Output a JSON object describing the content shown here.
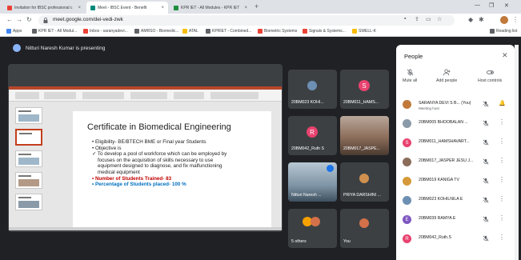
{
  "browser": {
    "tabs": [
      {
        "title": "Invitation for IBSC professional c",
        "color": "#e94235"
      },
      {
        "title": "Meet - IBSC Event - Benefit",
        "color": "#00897b"
      },
      {
        "title": "KPR IET - All Modules - KPR IET",
        "color": "#1e8e3e"
      }
    ],
    "new_tab": "+",
    "url": "meet.google.com/dei-vedi-zwk",
    "bookmarks": [
      {
        "label": "Apps",
        "color": "#4285f4"
      },
      {
        "label": "KPR IET - All Modul...",
        "color": "#5f6368"
      },
      {
        "label": "Inbox - saranyadevi...",
        "color": "#ea4335"
      },
      {
        "label": "AMRSO - Biomedic...",
        "color": "#5f6368"
      },
      {
        "label": "ATAL",
        "color": "#fbbc04"
      },
      {
        "label": "KPRIET - Combined...",
        "color": "#5f6368"
      },
      {
        "label": "Biometric Systems",
        "color": "#ea4335"
      },
      {
        "label": "Signals & Systems...",
        "color": "#ea4335"
      },
      {
        "label": "SWELL-K",
        "color": "#fbbc04"
      },
      {
        "label": "Reading list",
        "color": "#5f6368"
      }
    ]
  },
  "meet": {
    "presenter_banner": "Nitturi Naresh Kumar is presenting",
    "slide": {
      "title": "Certificate in Biomedical Engineering",
      "bullets": [
        {
          "text": "• Eligibility- BE/BTECH BME or Final year Students",
          "style": "normal"
        },
        {
          "text": "• Objective is",
          "style": "normal"
        },
        {
          "text": "✓ To develop a pool of workforce which can be employed by",
          "style": "normal"
        },
        {
          "text": "focuses on the acquisition of skills necessary to use",
          "style": "indent"
        },
        {
          "text": "equipment designed to diagnose, and fix malfunctioning",
          "style": "indent"
        },
        {
          "text": "medical equipment",
          "style": "indent"
        },
        {
          "text": "• Number of Students Trained- 83",
          "style": "red"
        },
        {
          "text": "• Percentage of Students placed- 100 %",
          "style": "blue"
        }
      ]
    },
    "tiles": [
      {
        "name": "20BM023 KOHI...",
        "kind": "photo",
        "avatar_color": "#6d8fb3"
      },
      {
        "name": "20BM011_HAMS...",
        "kind": "letter",
        "letter": "S",
        "avatar_color": "#e8426f"
      },
      {
        "name": "20BM042_Ruth S",
        "kind": "letter",
        "letter": "R",
        "avatar_color": "#e8426f"
      },
      {
        "name": "20BM017_JASPE...",
        "kind": "video",
        "avatar_color": "#8c6d5a"
      },
      {
        "name": "Nitturi Naresh ...",
        "kind": "video",
        "avatar_color": "#5a7a8c"
      },
      {
        "name": "PRIYA DARSHINI ...",
        "kind": "photo",
        "avatar_color": "#d09050"
      },
      {
        "name": "5 others",
        "kind": "others",
        "avatar_color": "#f7a100"
      },
      {
        "name": "You",
        "kind": "photo",
        "avatar_color": "#d4714a"
      }
    ]
  },
  "people_panel": {
    "title": "People",
    "actions": [
      {
        "label": "Mute all"
      },
      {
        "label": "Add people"
      },
      {
        "label": "Host controls"
      }
    ],
    "participants": [
      {
        "name": "SARANYA DEVI S B...",
        "tag": "(You)",
        "sub": "Meeting host",
        "avatar": "",
        "color": "#c0793a"
      },
      {
        "name": "20BM005 BHOOBALAN ...",
        "tag": "",
        "sub": "",
        "avatar": "",
        "color": "#8a9aa8"
      },
      {
        "name": "20BM011_HAMSHAVART...",
        "tag": "",
        "sub": "",
        "avatar": "S",
        "color": "#e8426f"
      },
      {
        "name": "20BM017_JASPER JESU J...",
        "tag": "",
        "sub": "",
        "avatar": "",
        "color": "#8c6d5a"
      },
      {
        "name": "20BM019 KANIGA TV",
        "tag": "",
        "sub": "",
        "avatar": "",
        "color": "#d69a3a"
      },
      {
        "name": "20BM023 KOHILNILA E",
        "tag": "",
        "sub": "",
        "avatar": "",
        "color": "#6d8fb3"
      },
      {
        "name": "20BM039 RAMYA E",
        "tag": "",
        "sub": "",
        "avatar": "E",
        "color": "#7e57c2"
      },
      {
        "name": "20BM042_Ruth.S",
        "tag": "",
        "sub": "",
        "avatar": "R",
        "color": "#e8426f"
      }
    ]
  }
}
